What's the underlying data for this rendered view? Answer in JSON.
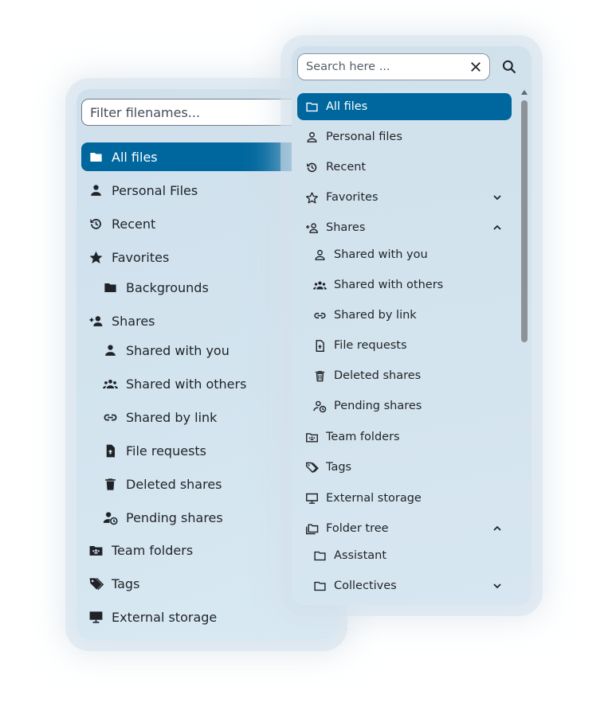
{
  "back_panel": {
    "filter_placeholder": "Filter filenames...",
    "items": [
      {
        "label": "All files",
        "icon": "folder-icon",
        "active": true
      },
      {
        "label": "Personal Files",
        "icon": "person-icon"
      },
      {
        "label": "Recent",
        "icon": "history-icon"
      },
      {
        "label": "Favorites",
        "icon": "star-icon"
      },
      {
        "label": "Backgrounds",
        "icon": "folder-icon"
      },
      {
        "label": "Shares",
        "icon": "share-person-icon"
      },
      {
        "label": "Shared with you",
        "icon": "person-icon"
      },
      {
        "label": "Shared with others",
        "icon": "group-icon"
      },
      {
        "label": "Shared by link",
        "icon": "link-icon"
      },
      {
        "label": "File requests",
        "icon": "file-upload-icon"
      },
      {
        "label": "Deleted shares",
        "icon": "trash-icon"
      },
      {
        "label": "Pending shares",
        "icon": "pending-person-icon"
      },
      {
        "label": "Team folders",
        "icon": "team-folder-icon"
      },
      {
        "label": "Tags",
        "icon": "tag-icon"
      },
      {
        "label": "External storage",
        "icon": "monitor-icon"
      }
    ]
  },
  "front_panel": {
    "search_placeholder": "Search here ...",
    "items": [
      {
        "label": "All files",
        "icon": "folder-outline-icon",
        "active": true
      },
      {
        "label": "Personal files",
        "icon": "person-outline-icon"
      },
      {
        "label": "Recent",
        "icon": "history-icon"
      },
      {
        "label": "Favorites",
        "icon": "star-outline-icon",
        "chevron": "down"
      },
      {
        "label": "Shares",
        "icon": "share-person-outline-icon",
        "chevron": "up"
      },
      {
        "label": "Shared with you",
        "icon": "person-outline-icon"
      },
      {
        "label": "Shared with others",
        "icon": "group-icon"
      },
      {
        "label": "Shared by link",
        "icon": "link-icon"
      },
      {
        "label": "File requests",
        "icon": "file-upload-outline-icon"
      },
      {
        "label": "Deleted shares",
        "icon": "trash-outline-icon"
      },
      {
        "label": "Pending shares",
        "icon": "pending-person-outline-icon"
      },
      {
        "label": "Team folders",
        "icon": "team-folder-outline-icon"
      },
      {
        "label": "Tags",
        "icon": "tag-outline-icon"
      },
      {
        "label": "External storage",
        "icon": "monitor-outline-icon"
      },
      {
        "label": "Folder tree",
        "icon": "folder-multiple-outline-icon",
        "chevron": "up"
      },
      {
        "label": "Assistant",
        "icon": "folder-outline-icon"
      },
      {
        "label": "Collectives",
        "icon": "folder-outline-icon",
        "chevron": "down"
      }
    ]
  },
  "colors": {
    "accent": "#00679e",
    "panel_bg": "#d1e1ec",
    "text": "#1f2328"
  }
}
